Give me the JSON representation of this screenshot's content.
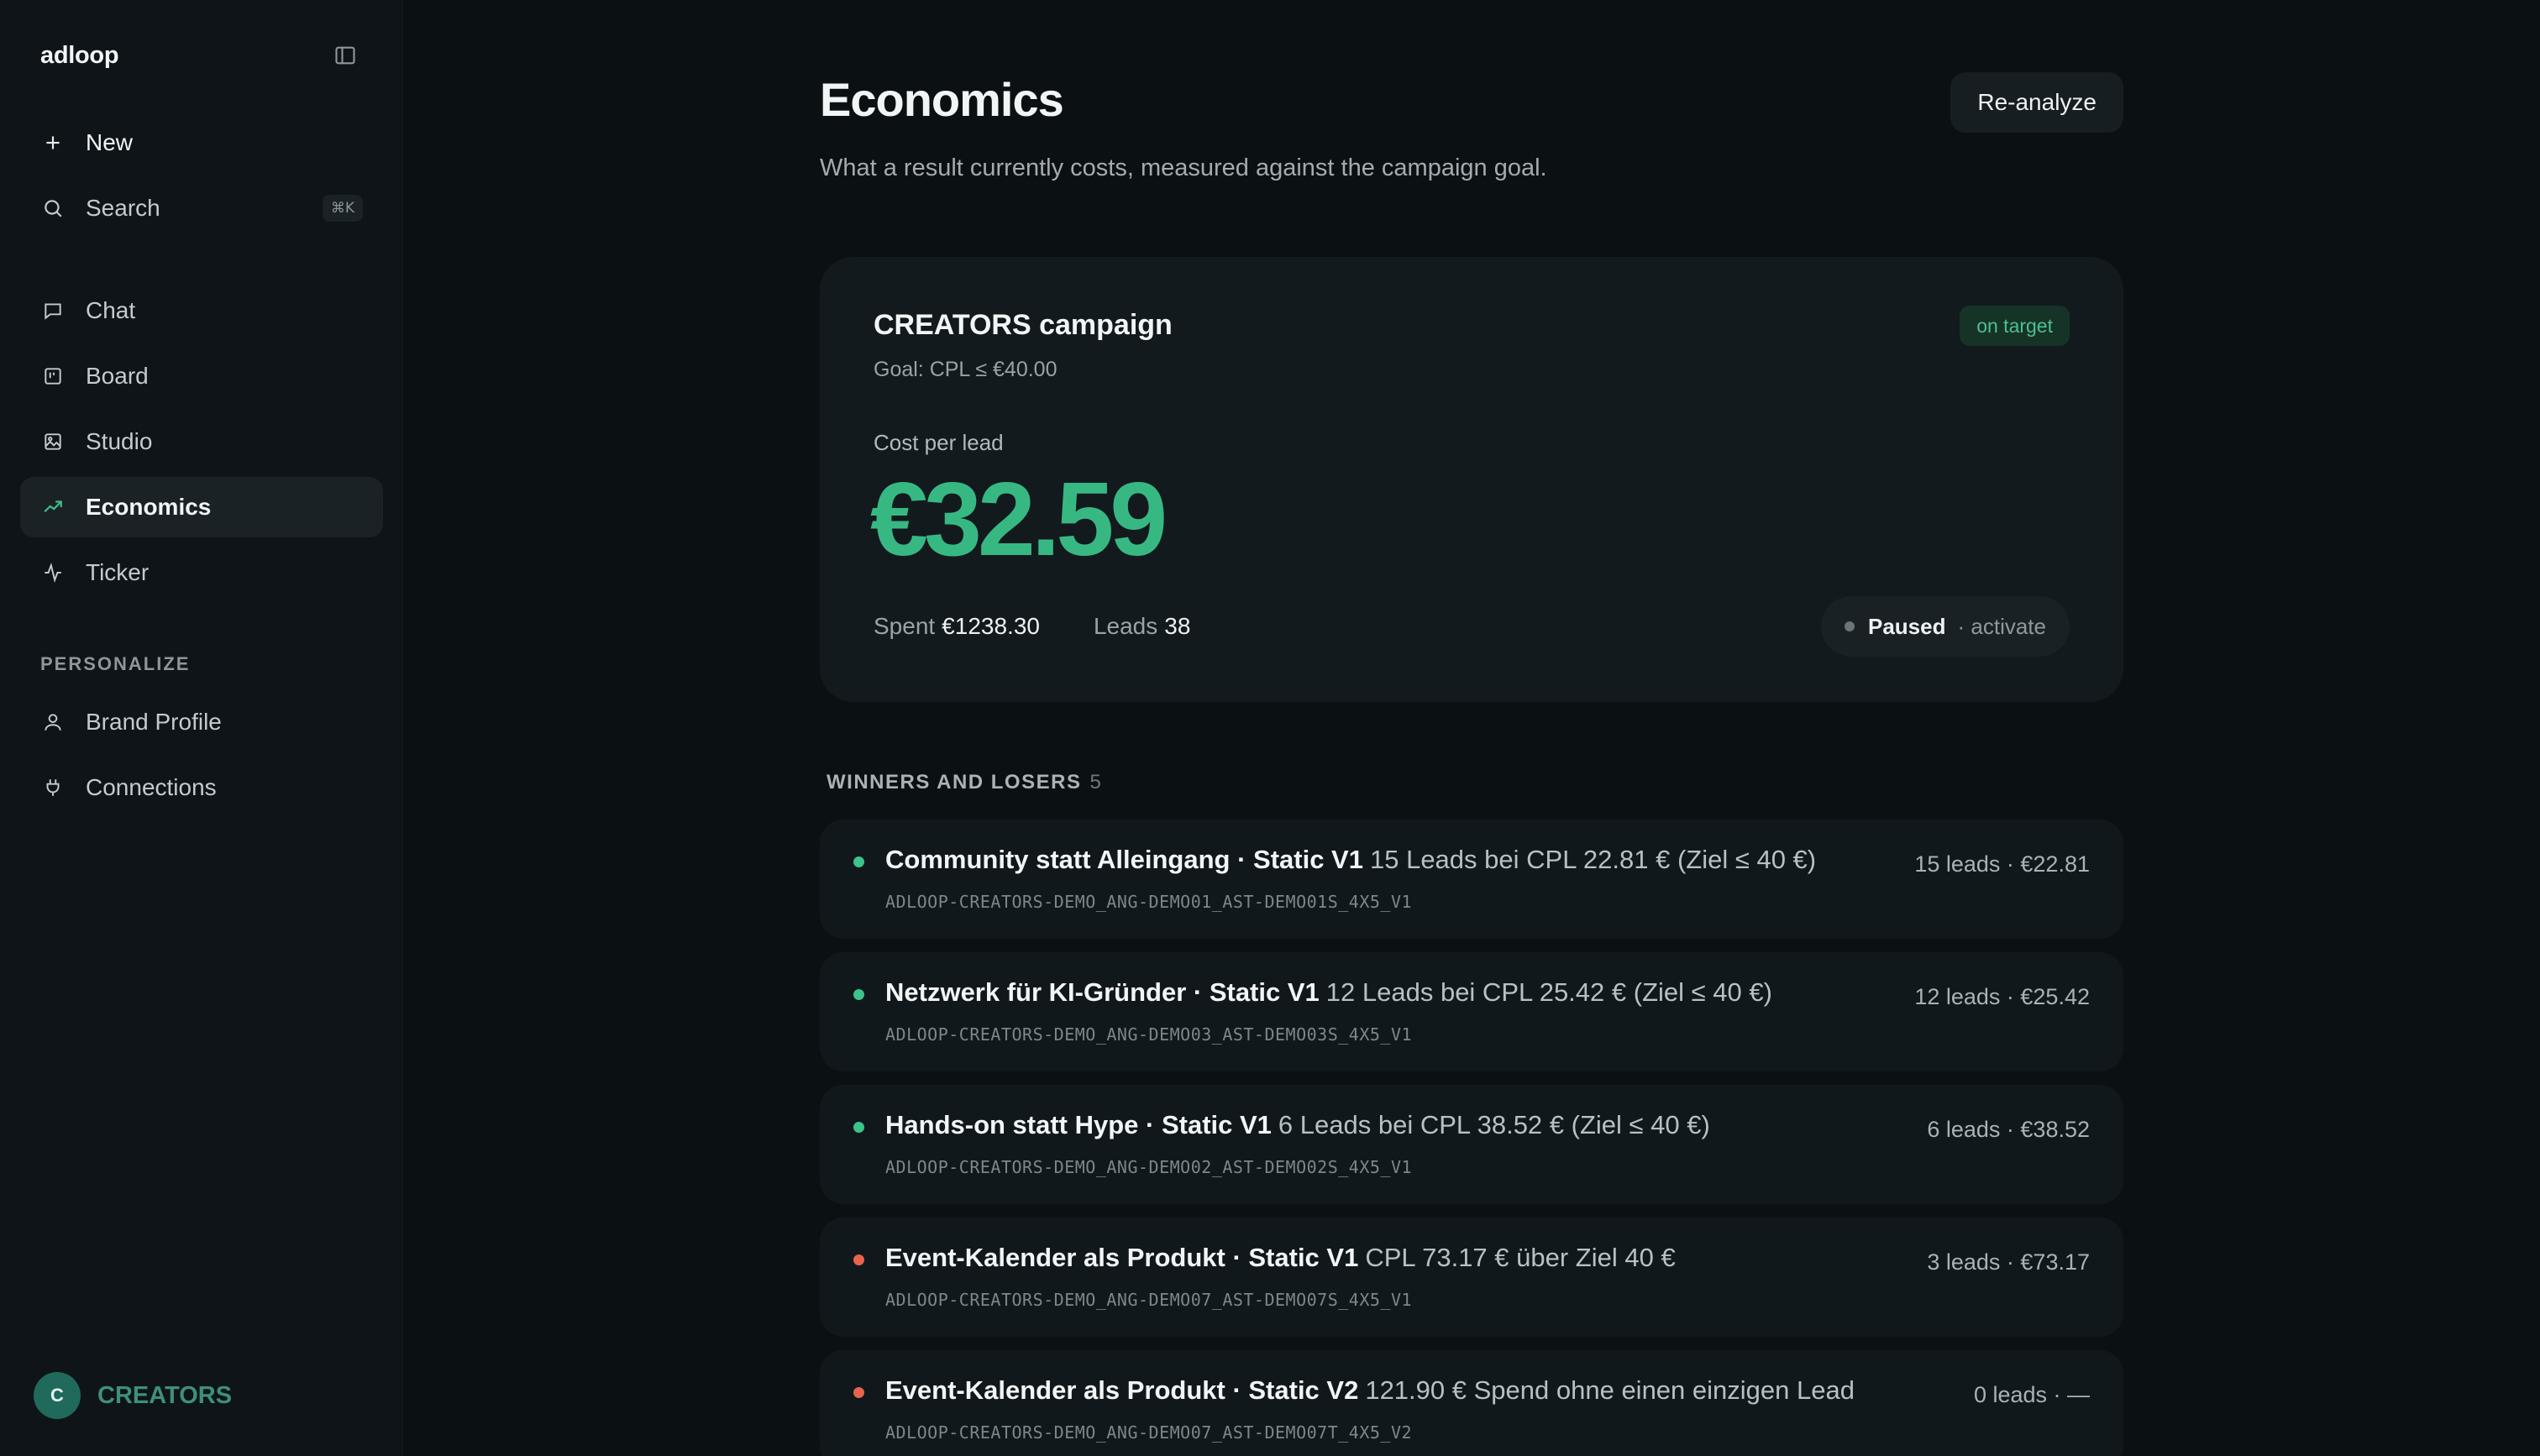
{
  "sidebar": {
    "brand": "adloop",
    "new_label": "New",
    "search_label": "Search",
    "search_shortcut": "⌘K",
    "nav": [
      {
        "label": "Chat",
        "icon": "chat-icon"
      },
      {
        "label": "Board",
        "icon": "board-icon"
      },
      {
        "label": "Studio",
        "icon": "image-icon"
      },
      {
        "label": "Economics",
        "icon": "trend-icon",
        "active": true
      },
      {
        "label": "Ticker",
        "icon": "pulse-icon"
      }
    ],
    "personalize_label": "PERSONALIZE",
    "personalize": [
      {
        "label": "Brand Profile",
        "icon": "user-icon"
      },
      {
        "label": "Connections",
        "icon": "plug-icon"
      }
    ],
    "workspace": {
      "initial": "C",
      "name": "CREATORS"
    }
  },
  "page": {
    "title": "Economics",
    "subtitle": "What a result currently costs, measured against the campaign goal.",
    "reanalyze_label": "Re-analyze"
  },
  "campaign": {
    "name": "CREATORS campaign",
    "goal": "Goal: CPL ≤ €40.00",
    "badge": "on target",
    "metric_label": "Cost per lead",
    "metric_value": "€32.59",
    "spent_label": "Spent",
    "spent_value": "€1238.30",
    "leads_label": "Leads",
    "leads_value": "38",
    "status": "Paused",
    "status_action": "· activate"
  },
  "winners": {
    "heading": "WINNERS AND LOSERS",
    "count": "5",
    "rows": [
      {
        "title": "Community statt Alleingang · Static V1",
        "desc": "15 Leads bei CPL 22.81 € (Ziel ≤ 40 €)",
        "id": "ADLOOP-CREATORS-DEMO_ANG-DEMO01_AST-DEMO01S_4X5_V1",
        "meta": "15 leads · €22.81",
        "status": "winner"
      },
      {
        "title": "Netzwerk für KI-Gründer · Static V1",
        "desc": "12 Leads bei CPL 25.42 € (Ziel ≤ 40 €)",
        "id": "ADLOOP-CREATORS-DEMO_ANG-DEMO03_AST-DEMO03S_4X5_V1",
        "meta": "12 leads · €25.42",
        "status": "winner"
      },
      {
        "title": "Hands-on statt Hype · Static V1",
        "desc": "6 Leads bei CPL 38.52 € (Ziel ≤ 40 €)",
        "id": "ADLOOP-CREATORS-DEMO_ANG-DEMO02_AST-DEMO02S_4X5_V1",
        "meta": "6 leads · €38.52",
        "status": "winner"
      },
      {
        "title": "Event-Kalender als Produkt · Static V1",
        "desc": "CPL 73.17 € über Ziel 40 €",
        "id": "ADLOOP-CREATORS-DEMO_ANG-DEMO07_AST-DEMO07S_4X5_V1",
        "meta": "3 leads · €73.17",
        "status": "loser"
      },
      {
        "title": "Event-Kalender als Produkt · Static V2",
        "desc": "121.90 € Spend ohne einen einzigen Lead",
        "id": "ADLOOP-CREATORS-DEMO_ANG-DEMO07_AST-DEMO07T_4X5_V2",
        "meta": "0 leads · —",
        "status": "loser"
      }
    ]
  },
  "colors": {
    "accent": "#37b883",
    "winner_dot": "#3cc48a",
    "loser_dot": "#e8644c",
    "background": "#0b1013",
    "sidebar": "#0e1417"
  }
}
